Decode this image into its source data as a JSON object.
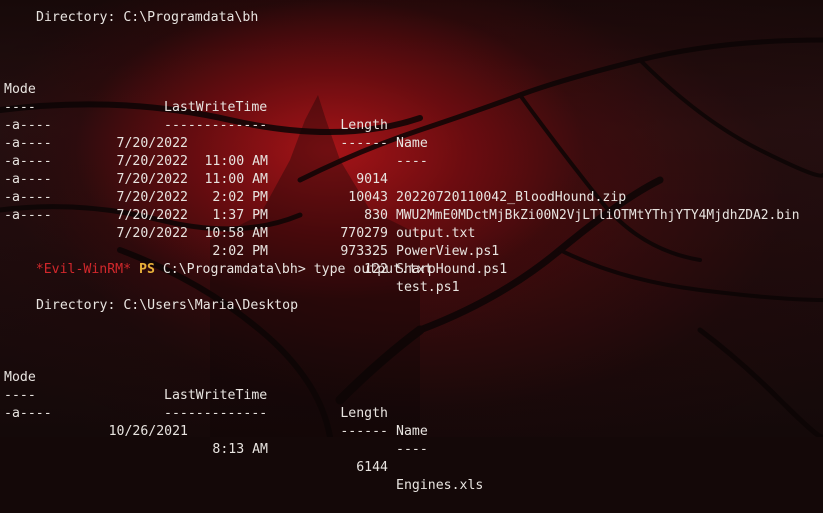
{
  "colors": {
    "text": "#e8e4e0",
    "prompt_name": "#d2282c",
    "prompt_ps": "#e8b23a",
    "background_glow": "#a0141a"
  },
  "listing1": {
    "directory_line": "Directory: C:\\Programdata\\bh",
    "headers": {
      "mode": "Mode",
      "lastwritetime": "LastWriteTime",
      "length": "Length",
      "name": "Name"
    },
    "separators": {
      "mode": "----",
      "lastwritetime": "-------------",
      "length": "------",
      "name": "----"
    },
    "rows": [
      {
        "mode": "-a----",
        "date": "7/20/2022",
        "time": "11:00 AM",
        "length": "9014",
        "name": "20220720110042_BloodHound.zip"
      },
      {
        "mode": "-a----",
        "date": "7/20/2022",
        "time": "11:00 AM",
        "length": "10043",
        "name": "MWU2MmE0MDctMjBkZi00N2VjLTliOTMtYThjYTY4MjdhZDA2.bin"
      },
      {
        "mode": "-a----",
        "date": "7/20/2022",
        "time": "2:02 PM",
        "length": "830",
        "name": "output.txt"
      },
      {
        "mode": "-a----",
        "date": "7/20/2022",
        "time": "1:37 PM",
        "length": "770279",
        "name": "PowerView.ps1"
      },
      {
        "mode": "-a----",
        "date": "7/20/2022",
        "time": "10:58 AM",
        "length": "973325",
        "name": "SharpHound.ps1"
      },
      {
        "mode": "-a----",
        "date": "7/20/2022",
        "time": "2:02 PM",
        "length": "122",
        "name": "test.ps1"
      }
    ]
  },
  "prompt": {
    "name": "*Evil-WinRM*",
    "shell": "PS",
    "path": "C:\\Programdata\\bh>",
    "command": "type output.txt"
  },
  "listing2": {
    "directory_line": "Directory: C:\\Users\\Maria\\Desktop",
    "headers": {
      "mode": "Mode",
      "lastwritetime": "LastWriteTime",
      "length": "Length",
      "name": "Name"
    },
    "separators": {
      "mode": "----",
      "lastwritetime": "-------------",
      "length": "------",
      "name": "----"
    },
    "rows": [
      {
        "mode": "-a----",
        "date": "10/26/2021",
        "time": "8:13 AM",
        "length": "6144",
        "name": "Engines.xls"
      }
    ]
  }
}
